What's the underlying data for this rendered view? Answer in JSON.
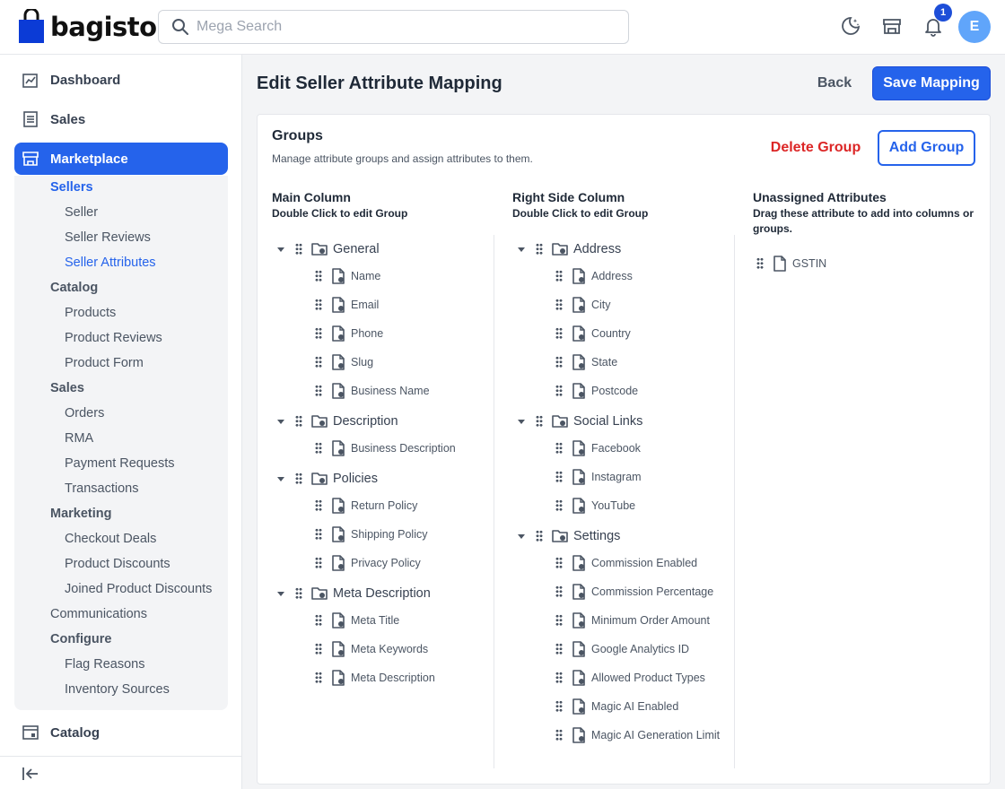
{
  "brand": {
    "name": "bagisto"
  },
  "search": {
    "placeholder": "Mega Search"
  },
  "header": {
    "notification_count": "1",
    "avatar_letter": "E"
  },
  "sidebar": {
    "dashboard": "Dashboard",
    "sales": "Sales",
    "marketplace": "Marketplace",
    "catalog": "Catalog",
    "sub": {
      "sellers_group": "Sellers",
      "sellers": "Seller",
      "seller_reviews": "Seller Reviews",
      "seller_attributes": "Seller Attributes",
      "catalog_group": "Catalog",
      "products": "Products",
      "product_reviews": "Product Reviews",
      "product_form": "Product Form",
      "sales_group": "Sales",
      "orders": "Orders",
      "rma": "RMA",
      "payment_requests": "Payment Requests",
      "transactions": "Transactions",
      "marketing_group": "Marketing",
      "checkout_deals": "Checkout Deals",
      "product_discounts": "Product Discounts",
      "joined_product_discounts": "Joined Product Discounts",
      "communications_group": "Communications",
      "configure_group": "Configure",
      "flag_reasons": "Flag Reasons",
      "inventory_sources": "Inventory Sources"
    }
  },
  "page": {
    "title": "Edit Seller Attribute Mapping",
    "back": "Back",
    "save": "Save Mapping"
  },
  "groups": {
    "title": "Groups",
    "subtitle": "Manage attribute groups and assign attributes to them.",
    "delete": "Delete Group",
    "add": "Add Group"
  },
  "columns": {
    "main": {
      "title": "Main Column",
      "hint": "Double Click to edit Group",
      "groups": [
        {
          "name": "General",
          "attributes": [
            "Name",
            "Email",
            "Phone",
            "Slug",
            "Business Name"
          ]
        },
        {
          "name": "Description",
          "attributes": [
            "Business Description"
          ]
        },
        {
          "name": "Policies",
          "attributes": [
            "Return Policy",
            "Shipping Policy",
            "Privacy Policy"
          ]
        },
        {
          "name": "Meta Description",
          "attributes": [
            "Meta Title",
            "Meta Keywords",
            "Meta Description"
          ]
        }
      ]
    },
    "right": {
      "title": "Right Side Column",
      "hint": "Double Click to edit Group",
      "groups": [
        {
          "name": "Address",
          "attributes": [
            "Address",
            "City",
            "Country",
            "State",
            "Postcode"
          ]
        },
        {
          "name": "Social Links",
          "attributes": [
            "Facebook",
            "Instagram",
            "YouTube"
          ]
        },
        {
          "name": "Settings",
          "attributes": [
            "Commission Enabled",
            "Commission Percentage",
            "Minimum Order Amount",
            "Google Analytics ID",
            "Allowed Product Types",
            "Magic AI Enabled",
            "Magic AI Generation Limit"
          ]
        }
      ]
    },
    "unassigned": {
      "title": "Unassigned Attributes",
      "hint": "Drag these attribute to add into columns or groups.",
      "attributes": [
        "GSTIN"
      ]
    }
  }
}
